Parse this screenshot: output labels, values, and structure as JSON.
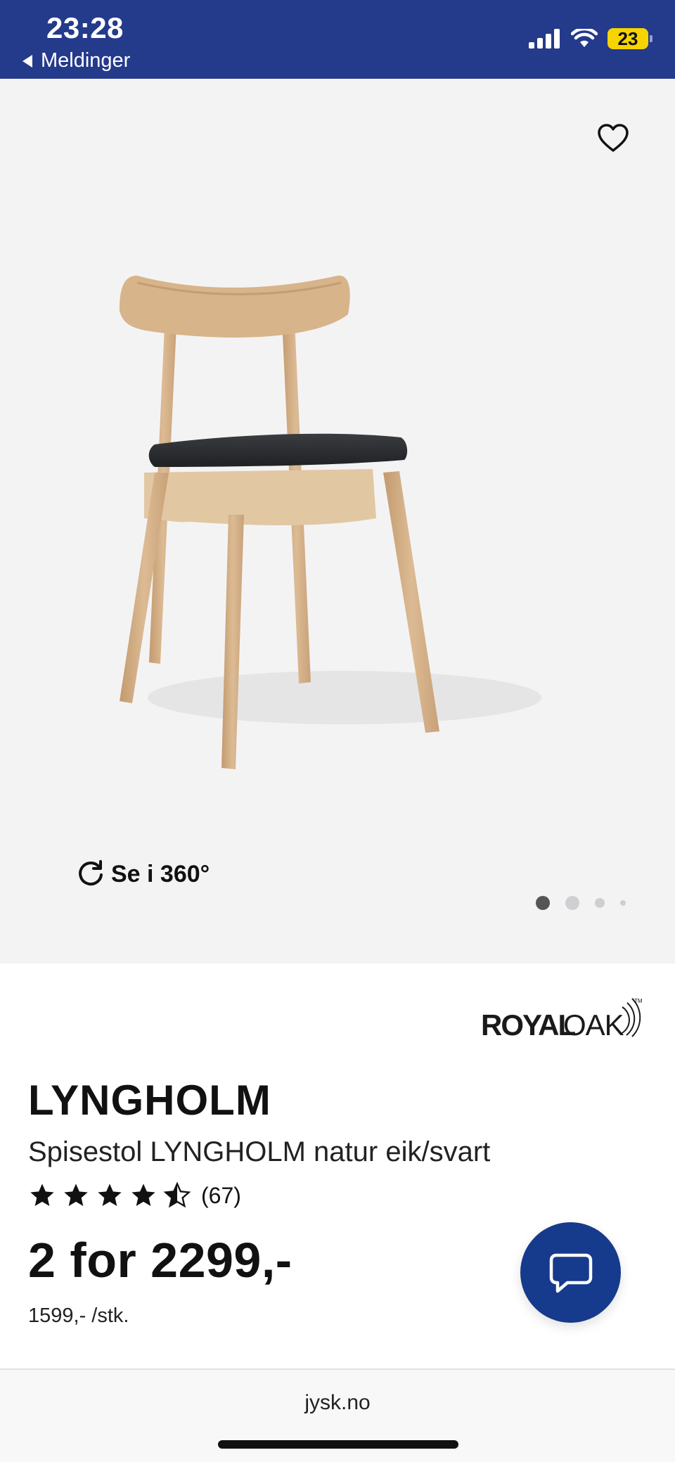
{
  "status_bar": {
    "time": "23:28",
    "back_label": "Meldinger",
    "battery": "23",
    "background": "#243a8b"
  },
  "product": {
    "view360_label": "Se i 360°",
    "carousel": {
      "count": 4,
      "active": 1
    },
    "brand_logo_text": "ROYALOAK",
    "name": "LYNGHOLM",
    "description": "Spisestol LYNGHOLM natur eik/svart",
    "rating": {
      "stars": 4.5,
      "count_label": "(67)"
    },
    "price": "2 for 2299,-",
    "unit_price": "1599,- /stk."
  },
  "browser": {
    "url": "jysk.no"
  },
  "colors": {
    "accent": "#163a8c",
    "image_bg": "#f4f3f4"
  },
  "icons": [
    "signal-icon",
    "wifi-icon",
    "battery-icon",
    "heart-icon",
    "rotate-360-icon",
    "star-icon",
    "chat-icon"
  ]
}
